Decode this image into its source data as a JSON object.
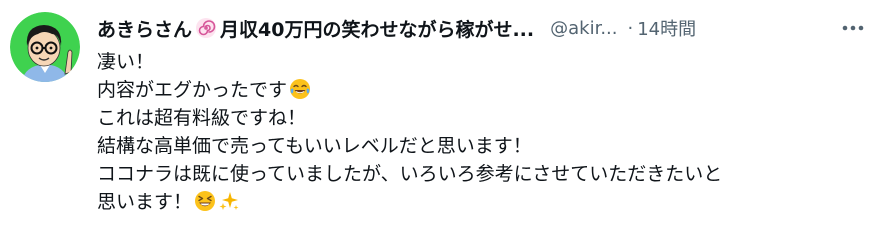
{
  "tweet": {
    "author": {
      "display_name": "あきらさん",
      "display_name_suffix": "月収40万円の笑わせながら稼がせ...",
      "name_icon": "spiral-icon",
      "handle": "@akir...",
      "avatar_icon": "avatar-glasses-man-icon"
    },
    "separator": "·",
    "timestamp": "14時間",
    "more_icon": "more-dots-icon",
    "lines": [
      {
        "text": "凄い！",
        "emoji": []
      },
      {
        "text": "内容がエグかったです",
        "emoji": [
          "tears-of-joy-icon"
        ]
      },
      {
        "text": "これは超有料級ですね！",
        "emoji": []
      },
      {
        "text": "結構な高単価で売ってもいいレベルだと思います！",
        "emoji": []
      },
      {
        "text": "ココナラは既に使っていましたが、いろいろ参考にさせていただきたいと",
        "emoji": []
      },
      {
        "text": "思います！",
        "emoji": [
          "grinning-squint-icon",
          "sparkles-icon"
        ]
      }
    ]
  },
  "colors": {
    "text_primary": "#0f1419",
    "text_secondary": "#536471",
    "avatar_bg": "#3fd24f",
    "emoji_yellow": "#fcc21b",
    "sparkle": "#f7b500",
    "spiral": "#d6579a"
  }
}
